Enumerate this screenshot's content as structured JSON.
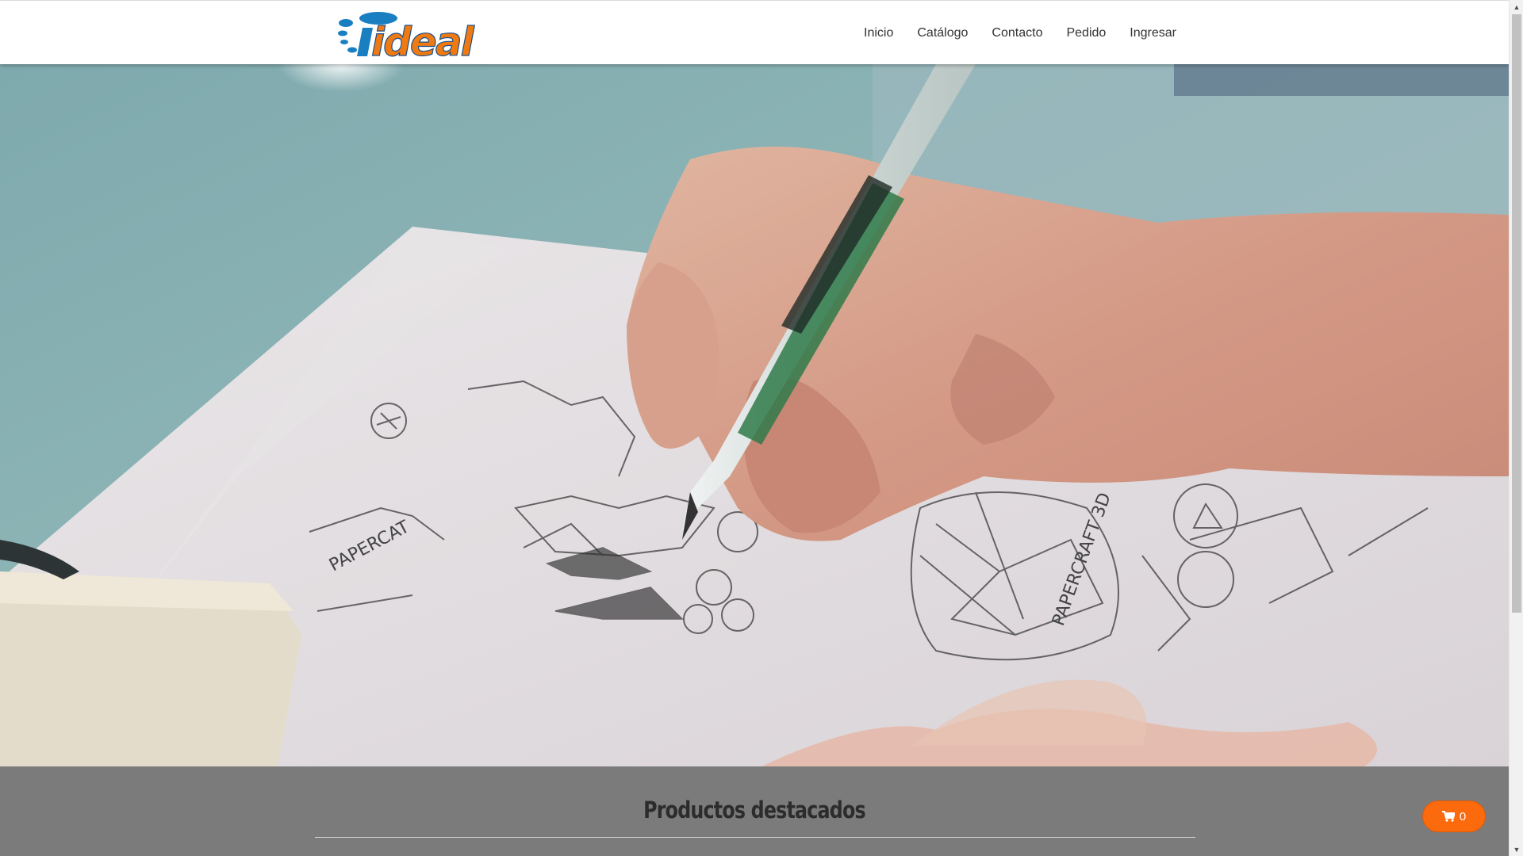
{
  "brand": {
    "logo_text": "ideal",
    "accent_color": "#f07a12",
    "logo_blue": "#1a7fc1"
  },
  "nav": {
    "items": [
      {
        "label": "Inicio"
      },
      {
        "label": "Catálogo"
      },
      {
        "label": "Contacto"
      },
      {
        "label": "Pedido"
      },
      {
        "label": "Ingresar"
      }
    ]
  },
  "hero": {
    "description": "photo-hand-sketching",
    "sketch_texts": [
      "PAPERCAT",
      "PAPERCRAFT 3D"
    ]
  },
  "featured": {
    "title": "Productos destacados"
  },
  "cart": {
    "icon": "cart-icon",
    "count": "0",
    "color": "#fb6a0c"
  },
  "scrollbar": {
    "up_icon": "chevron-up-icon",
    "down_icon": "chevron-down-icon"
  }
}
